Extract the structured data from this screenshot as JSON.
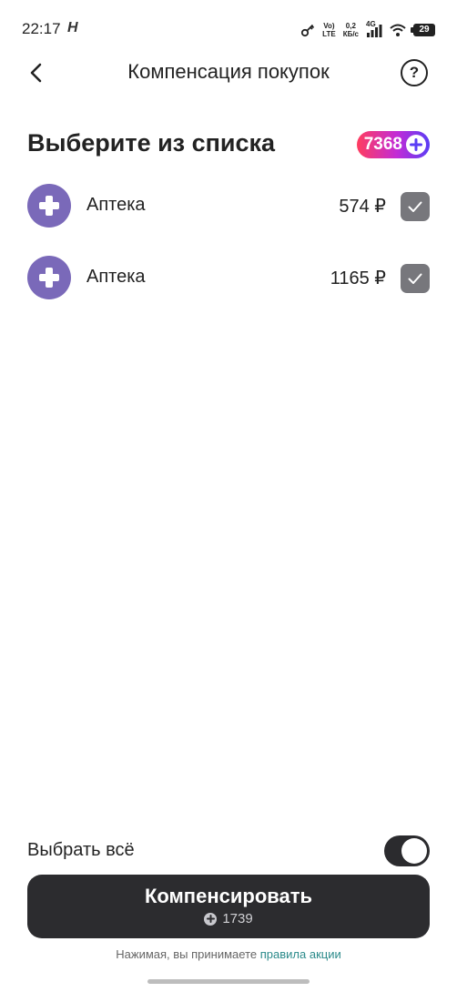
{
  "status_bar": {
    "time": "22:17",
    "h_icon": "H",
    "volte_top": "Vo)",
    "volte_bottom": "LTE",
    "speed_value": "0,2",
    "speed_unit": "КБ/с",
    "network": "4G",
    "battery": "29",
    "icons": [
      "key-icon",
      "signal-icon",
      "wifi-icon",
      "battery-icon"
    ]
  },
  "header": {
    "title": "Компенсация покупок",
    "back_icon": "chevron-left-icon",
    "help_icon": "question-circle-icon",
    "help_glyph": "?"
  },
  "section": {
    "title": "Выберите из списка",
    "balance": "7368",
    "balance_icon": "plus-points-icon"
  },
  "purchases": [
    {
      "name": "Аптека",
      "amount": "574 ₽",
      "checked": true,
      "icon": "pharmacy-cross-icon"
    },
    {
      "name": "Аптека",
      "amount": "1165 ₽",
      "checked": true,
      "icon": "pharmacy-cross-icon"
    }
  ],
  "select_all": {
    "label": "Выбрать всё",
    "on": true
  },
  "cta": {
    "label": "Компенсировать",
    "points": "1739",
    "points_icon": "plus-points-icon"
  },
  "footnote": {
    "text": "Нажимая, вы принимаете",
    "link": "правила акции"
  },
  "colors": {
    "avatar": "#7a69b9",
    "checkbox": "#77777c",
    "button": "#2c2c2f",
    "link": "#2a8a8a",
    "badge_gradient": [
      "#ff3d5f",
      "#c22bd6",
      "#5a3df5"
    ]
  }
}
